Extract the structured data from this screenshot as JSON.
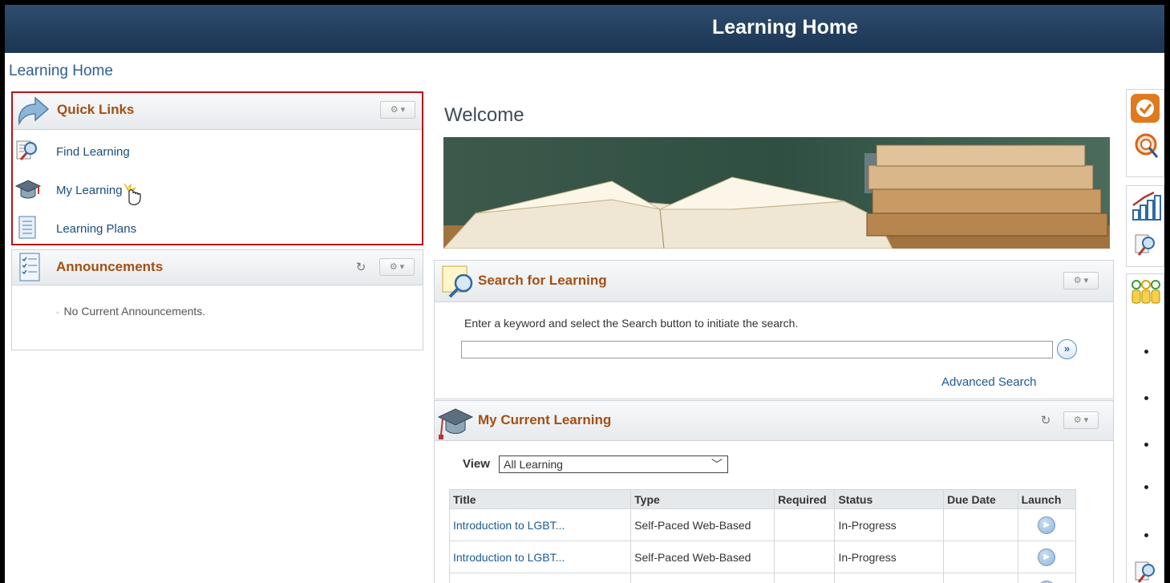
{
  "banner": {
    "title": "Learning Home"
  },
  "breadcrumb": "Learning Home",
  "quick_links": {
    "title": "Quick Links",
    "items": [
      {
        "label": "Find Learning",
        "icon": "magnifier-page-icon"
      },
      {
        "label": "My Learning",
        "icon": "graduation-cap-icon"
      },
      {
        "label": "Learning Plans",
        "icon": "checklist-icon"
      }
    ]
  },
  "announcements": {
    "title": "Announcements",
    "empty_text": "No Current Announcements."
  },
  "welcome": {
    "heading": "Welcome"
  },
  "search": {
    "title": "Search for Learning",
    "instructions": "Enter a keyword and select the Search button to initiate the search.",
    "input_value": "",
    "advanced_link": "Advanced Search"
  },
  "current_learning": {
    "title": "My Current Learning",
    "view_label": "View",
    "view_value": "All Learning",
    "columns": [
      "Title",
      "Type",
      "Required",
      "Status",
      "Due Date",
      "Launch"
    ],
    "rows": [
      {
        "title": "Introduction to LGBT...",
        "type": "Self-Paced Web-Based",
        "required": "",
        "status": "In-Progress",
        "due": ""
      },
      {
        "title": "Introduction to LGBT...",
        "type": "Self-Paced Web-Based",
        "required": "",
        "status": "In-Progress",
        "due": ""
      }
    ]
  },
  "colors": {
    "banner": "#1c3553",
    "pagelet_title": "#a44f12",
    "link": "#1b5a93",
    "highlight_border": "#b3141d"
  }
}
